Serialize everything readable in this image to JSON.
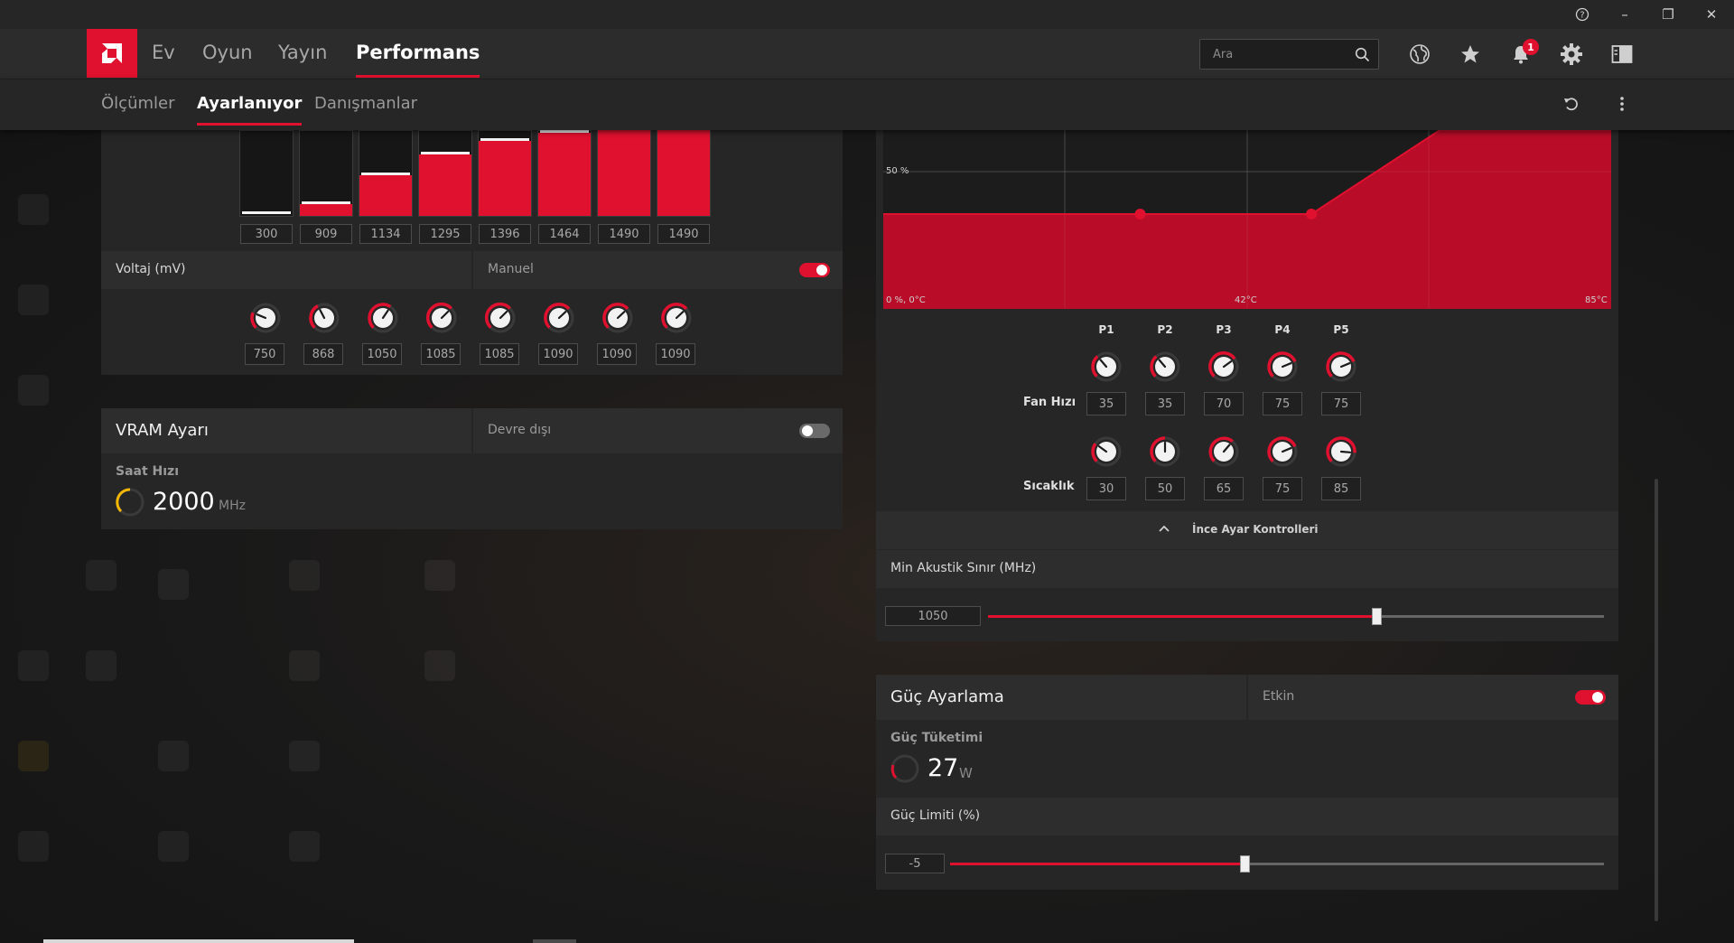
{
  "window": {
    "controls": {
      "help": "?",
      "minimize": "–",
      "restore": "❐",
      "close": "✕"
    }
  },
  "nav": {
    "items": [
      "Ev",
      "Oyun",
      "Yayın",
      "Performans"
    ],
    "search_placeholder": "Ara",
    "notification_count": "1"
  },
  "subnav": {
    "tabs": [
      "Ölçümler",
      "Ayarlanıyor",
      "Danışmanlar"
    ]
  },
  "gpu_tuning": {
    "clock_values": [
      "300",
      "909",
      "1134",
      "1295",
      "1396",
      "1464",
      "1490",
      "1490"
    ],
    "voltage_label": "Voltaj (mV)",
    "voltage_mode": "Manuel",
    "voltage_mode_on": true,
    "voltage_values": [
      "750",
      "868",
      "1050",
      "1085",
      "1085",
      "1090",
      "1090",
      "1090"
    ]
  },
  "vram": {
    "title": "VRAM Ayarı",
    "status": "Devre dışı",
    "enabled": false,
    "clock_label": "Saat Hızı",
    "clock_value": "2000",
    "clock_unit": "MHz"
  },
  "fan": {
    "label_50": "50 %",
    "label_origin": "0 %, 0°C",
    "label_mid": "42°C",
    "label_max": "85°C",
    "points": [
      "P1",
      "P2",
      "P3",
      "P4",
      "P5"
    ],
    "speed_label": "Fan Hızı",
    "speed_values": [
      "35",
      "35",
      "70",
      "75",
      "75"
    ],
    "temp_label": "Sıcaklık",
    "temp_values": [
      "30",
      "50",
      "65",
      "75",
      "85"
    ],
    "fine_tune_label": "İnce Ayar Kontrolleri",
    "min_acoustic_label": "Min Akustik Sınır (MHz)",
    "min_acoustic_value": "1050",
    "min_acoustic_fraction": 0.63
  },
  "power": {
    "title": "Güç Ayarlama",
    "status": "Etkin",
    "enabled": true,
    "consumption_label": "Güç Tüketimi",
    "consumption_value": "27",
    "consumption_unit": "W",
    "limit_label": "Güç Limiti (%)",
    "limit_value": "-5",
    "limit_fraction": 0.45
  },
  "colors": {
    "accent": "#e0102f",
    "panel": "#262626",
    "background": "#1a1a1a"
  }
}
